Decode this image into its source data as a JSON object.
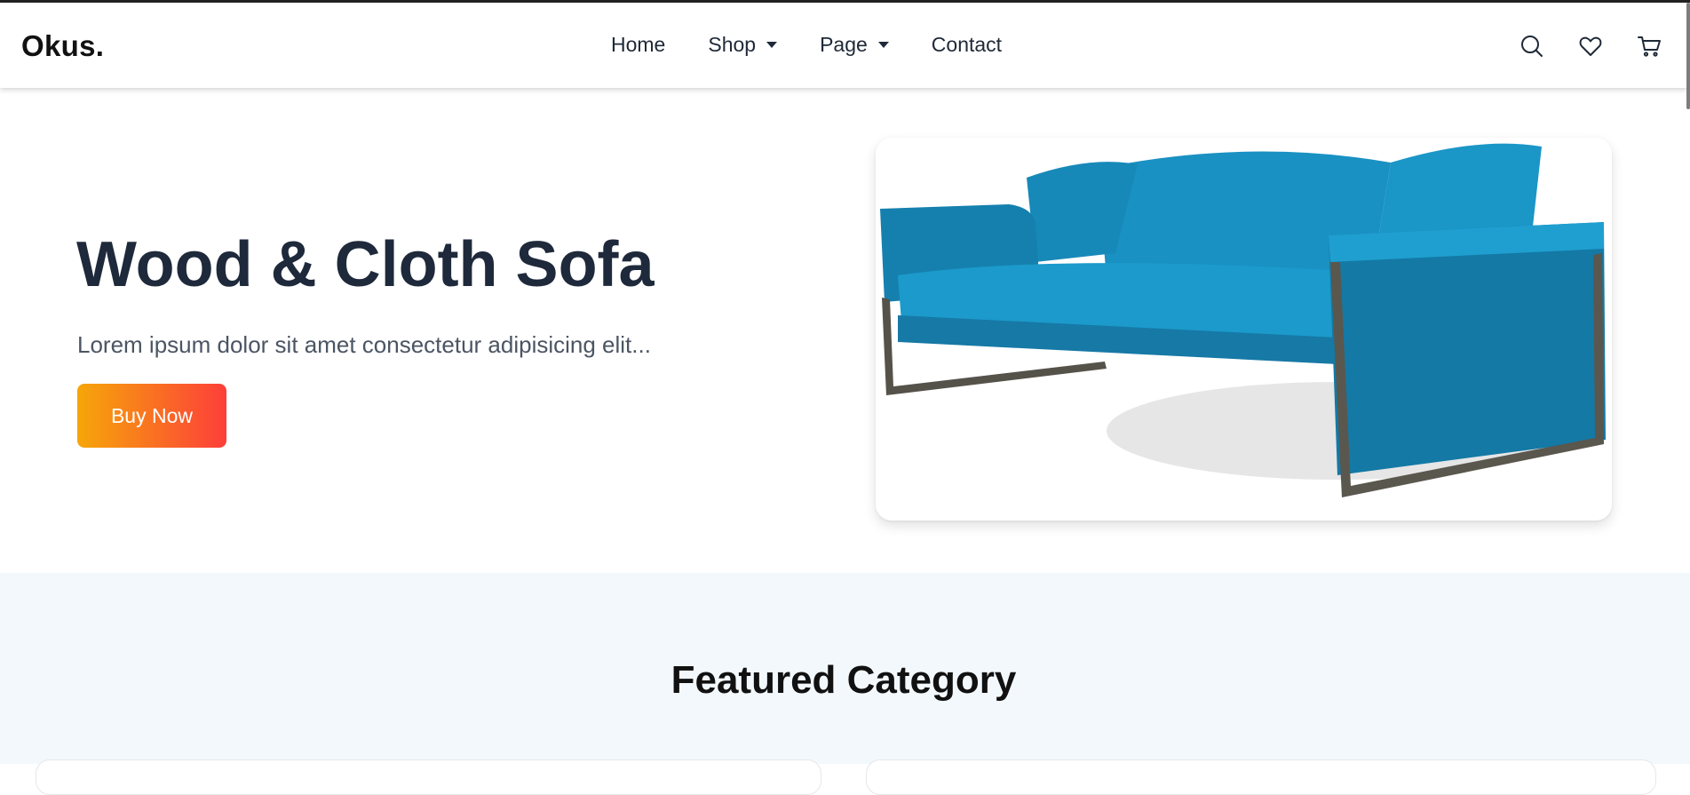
{
  "brand": {
    "logo": "Okus."
  },
  "nav": {
    "links": [
      {
        "label": "Home",
        "has_dropdown": false
      },
      {
        "label": "Shop",
        "has_dropdown": true
      },
      {
        "label": "Page",
        "has_dropdown": true
      },
      {
        "label": "Contact",
        "has_dropdown": false
      }
    ],
    "icons": [
      "search-icon",
      "heart-icon",
      "cart-icon"
    ]
  },
  "hero": {
    "title": "Wood & Cloth Sofa",
    "subtitle": "Lorem ipsum dolor sit amet consectetur adipisicing elit...",
    "button_label": "Buy Now",
    "image_subject": "blue-sofa-image"
  },
  "featured": {
    "title": "Featured Category"
  },
  "colors": {
    "gradient_start": "#f6a609",
    "gradient_end": "#fd3e3a",
    "sofa_blue": "#1a96c7",
    "section_bg": "#f3f8fd"
  }
}
